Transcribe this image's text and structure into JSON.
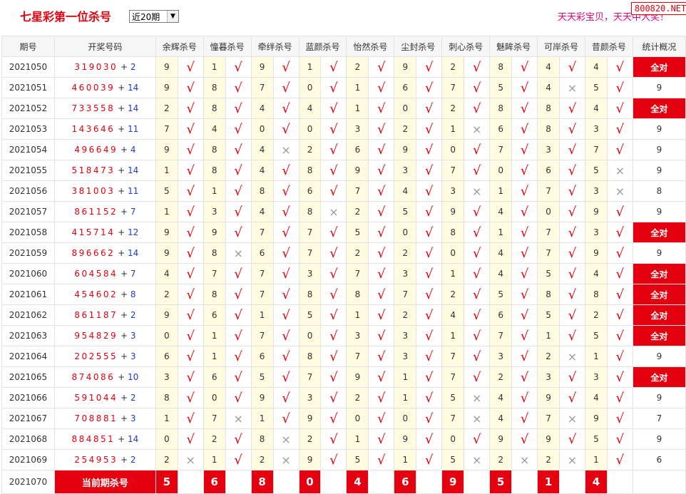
{
  "header": {
    "title": "七星彩第一位杀号",
    "select_value": "近20期",
    "slogan": "天天彩宝贝，天天中大奖！",
    "site_badge": "800820.NET"
  },
  "table": {
    "columns": [
      "期号",
      "开奖号码",
      "余辉杀号",
      "憧暮杀号",
      "牵绊杀号",
      "蓝颜杀号",
      "怡然杀号",
      "尘封杀号",
      "刺心杀号",
      "魅眸杀号",
      "可岸杀号",
      "昔颜杀号",
      "统计概况"
    ],
    "rows": [
      {
        "period": "2021050",
        "digits": "319030",
        "bonus": "2",
        "kills": [
          "9",
          "1",
          "9",
          "1",
          "2",
          "9",
          "2",
          "8",
          "4",
          "4"
        ],
        "marks": [
          "√",
          "√",
          "√",
          "√",
          "√",
          "√",
          "√",
          "√",
          "√",
          "√"
        ],
        "stat": "全对"
      },
      {
        "period": "2021051",
        "digits": "460039",
        "bonus": "14",
        "kills": [
          "9",
          "8",
          "7",
          "0",
          "1",
          "6",
          "7",
          "5",
          "4",
          "5"
        ],
        "marks": [
          "√",
          "√",
          "√",
          "√",
          "√",
          "√",
          "√",
          "√",
          "×",
          "√"
        ],
        "stat": "9"
      },
      {
        "period": "2021052",
        "digits": "733558",
        "bonus": "14",
        "kills": [
          "2",
          "8",
          "4",
          "4",
          "1",
          "0",
          "2",
          "8",
          "8",
          "4"
        ],
        "marks": [
          "√",
          "√",
          "√",
          "√",
          "√",
          "√",
          "√",
          "√",
          "√",
          "√"
        ],
        "stat": "全对"
      },
      {
        "period": "2021053",
        "digits": "143646",
        "bonus": "11",
        "kills": [
          "7",
          "4",
          "0",
          "0",
          "3",
          "2",
          "1",
          "6",
          "8",
          "3"
        ],
        "marks": [
          "√",
          "√",
          "√",
          "√",
          "√",
          "√",
          "×",
          "√",
          "√",
          "√"
        ],
        "stat": "9"
      },
      {
        "period": "2021054",
        "digits": "496649",
        "bonus": "4",
        "kills": [
          "9",
          "8",
          "4",
          "2",
          "6",
          "9",
          "0",
          "7",
          "3",
          "7"
        ],
        "marks": [
          "√",
          "√",
          "×",
          "√",
          "√",
          "√",
          "√",
          "√",
          "√",
          "√"
        ],
        "stat": "9"
      },
      {
        "period": "2021055",
        "digits": "518473",
        "bonus": "14",
        "kills": [
          "1",
          "8",
          "4",
          "8",
          "9",
          "3",
          "7",
          "0",
          "6",
          "5"
        ],
        "marks": [
          "√",
          "√",
          "√",
          "√",
          "√",
          "√",
          "√",
          "√",
          "√",
          "×"
        ],
        "stat": "9"
      },
      {
        "period": "2021056",
        "digits": "381003",
        "bonus": "11",
        "kills": [
          "5",
          "1",
          "8",
          "6",
          "7",
          "4",
          "3",
          "1",
          "7",
          "3"
        ],
        "marks": [
          "√",
          "√",
          "√",
          "√",
          "√",
          "√",
          "×",
          "√",
          "√",
          "×"
        ],
        "stat": "8"
      },
      {
        "period": "2021057",
        "digits": "861152",
        "bonus": "7",
        "kills": [
          "1",
          "3",
          "4",
          "8",
          "2",
          "5",
          "9",
          "4",
          "0",
          "9"
        ],
        "marks": [
          "√",
          "√",
          "√",
          "×",
          "√",
          "√",
          "√",
          "√",
          "√",
          "√"
        ],
        "stat": "9"
      },
      {
        "period": "2021058",
        "digits": "415714",
        "bonus": "12",
        "kills": [
          "9",
          "9",
          "7",
          "7",
          "5",
          "0",
          "8",
          "1",
          "7",
          "3"
        ],
        "marks": [
          "√",
          "√",
          "√",
          "√",
          "√",
          "√",
          "√",
          "√",
          "√",
          "√"
        ],
        "stat": "全对"
      },
      {
        "period": "2021059",
        "digits": "896662",
        "bonus": "14",
        "kills": [
          "9",
          "8",
          "6",
          "7",
          "2",
          "2",
          "0",
          "4",
          "7",
          "9"
        ],
        "marks": [
          "√",
          "×",
          "√",
          "√",
          "√",
          "√",
          "√",
          "√",
          "√",
          "√"
        ],
        "stat": "9"
      },
      {
        "period": "2021060",
        "digits": "604584",
        "bonus": "7",
        "kills": [
          "4",
          "7",
          "7",
          "3",
          "7",
          "3",
          "1",
          "4",
          "5",
          "4"
        ],
        "marks": [
          "√",
          "√",
          "√",
          "√",
          "√",
          "√",
          "√",
          "√",
          "√",
          "√"
        ],
        "stat": "全对"
      },
      {
        "period": "2021061",
        "digits": "454602",
        "bonus": "8",
        "kills": [
          "2",
          "8",
          "7",
          "8",
          "8",
          "7",
          "2",
          "5",
          "8",
          "8"
        ],
        "marks": [
          "√",
          "√",
          "√",
          "√",
          "√",
          "√",
          "√",
          "√",
          "√",
          "√"
        ],
        "stat": "全对"
      },
      {
        "period": "2021062",
        "digits": "861187",
        "bonus": "2",
        "kills": [
          "9",
          "6",
          "1",
          "5",
          "1",
          "2",
          "4",
          "6",
          "5",
          "2"
        ],
        "marks": [
          "√",
          "√",
          "√",
          "√",
          "√",
          "√",
          "√",
          "√",
          "√",
          "√"
        ],
        "stat": "全对"
      },
      {
        "period": "2021063",
        "digits": "954829",
        "bonus": "3",
        "kills": [
          "0",
          "1",
          "7",
          "0",
          "3",
          "3",
          "1",
          "7",
          "1",
          "5"
        ],
        "marks": [
          "√",
          "√",
          "√",
          "√",
          "√",
          "√",
          "√",
          "√",
          "√",
          "√"
        ],
        "stat": "全对"
      },
      {
        "period": "2021064",
        "digits": "202555",
        "bonus": "3",
        "kills": [
          "6",
          "1",
          "6",
          "8",
          "7",
          "3",
          "7",
          "3",
          "2",
          "1"
        ],
        "marks": [
          "√",
          "√",
          "√",
          "√",
          "√",
          "√",
          "√",
          "√",
          "×",
          "√"
        ],
        "stat": "9"
      },
      {
        "period": "2021065",
        "digits": "874086",
        "bonus": "10",
        "kills": [
          "3",
          "6",
          "5",
          "7",
          "9",
          "1",
          "7",
          "2",
          "3",
          "3"
        ],
        "marks": [
          "√",
          "√",
          "√",
          "√",
          "√",
          "√",
          "√",
          "√",
          "√",
          "√"
        ],
        "stat": "全对"
      },
      {
        "period": "2021066",
        "digits": "591044",
        "bonus": "2",
        "kills": [
          "8",
          "0",
          "9",
          "3",
          "2",
          "1",
          "5",
          "4",
          "9",
          "4"
        ],
        "marks": [
          "√",
          "√",
          "√",
          "√",
          "√",
          "√",
          "×",
          "√",
          "√",
          "√"
        ],
        "stat": "9"
      },
      {
        "period": "2021067",
        "digits": "708881",
        "bonus": "3",
        "kills": [
          "1",
          "7",
          "1",
          "9",
          "0",
          "0",
          "7",
          "4",
          "7",
          "9"
        ],
        "marks": [
          "√",
          "×",
          "√",
          "√",
          "√",
          "√",
          "×",
          "√",
          "×",
          "√"
        ],
        "stat": "7"
      },
      {
        "period": "2021068",
        "digits": "884851",
        "bonus": "14",
        "kills": [
          "0",
          "2",
          "8",
          "2",
          "1",
          "9",
          "0",
          "9",
          "9",
          "5"
        ],
        "marks": [
          "√",
          "√",
          "×",
          "√",
          "√",
          "√",
          "√",
          "√",
          "√",
          "√"
        ],
        "stat": "9"
      },
      {
        "period": "2021069",
        "digits": "254953",
        "bonus": "2",
        "kills": [
          "2",
          "1",
          "2",
          "9",
          "5",
          "1",
          "5",
          "2",
          "2",
          "1"
        ],
        "marks": [
          "×",
          "√",
          "×",
          "√",
          "√",
          "√",
          "×",
          "×",
          "×",
          "√"
        ],
        "stat": "6"
      }
    ],
    "current": {
      "period": "2021070",
      "label": "当前期杀号",
      "kills": [
        "5",
        "6",
        "8",
        "0",
        "4",
        "6",
        "9",
        "5",
        "1",
        "4"
      ]
    }
  },
  "colors": {
    "accent_red": "#e4000f",
    "bonus_blue": "#1e3cc8",
    "kill_cell_bg": "#fffbe0",
    "header_bg": "#f6f6f6",
    "slogan_pink": "#e4007f"
  },
  "icons": {
    "hit": "checkmark-icon",
    "miss": "cross-icon"
  }
}
